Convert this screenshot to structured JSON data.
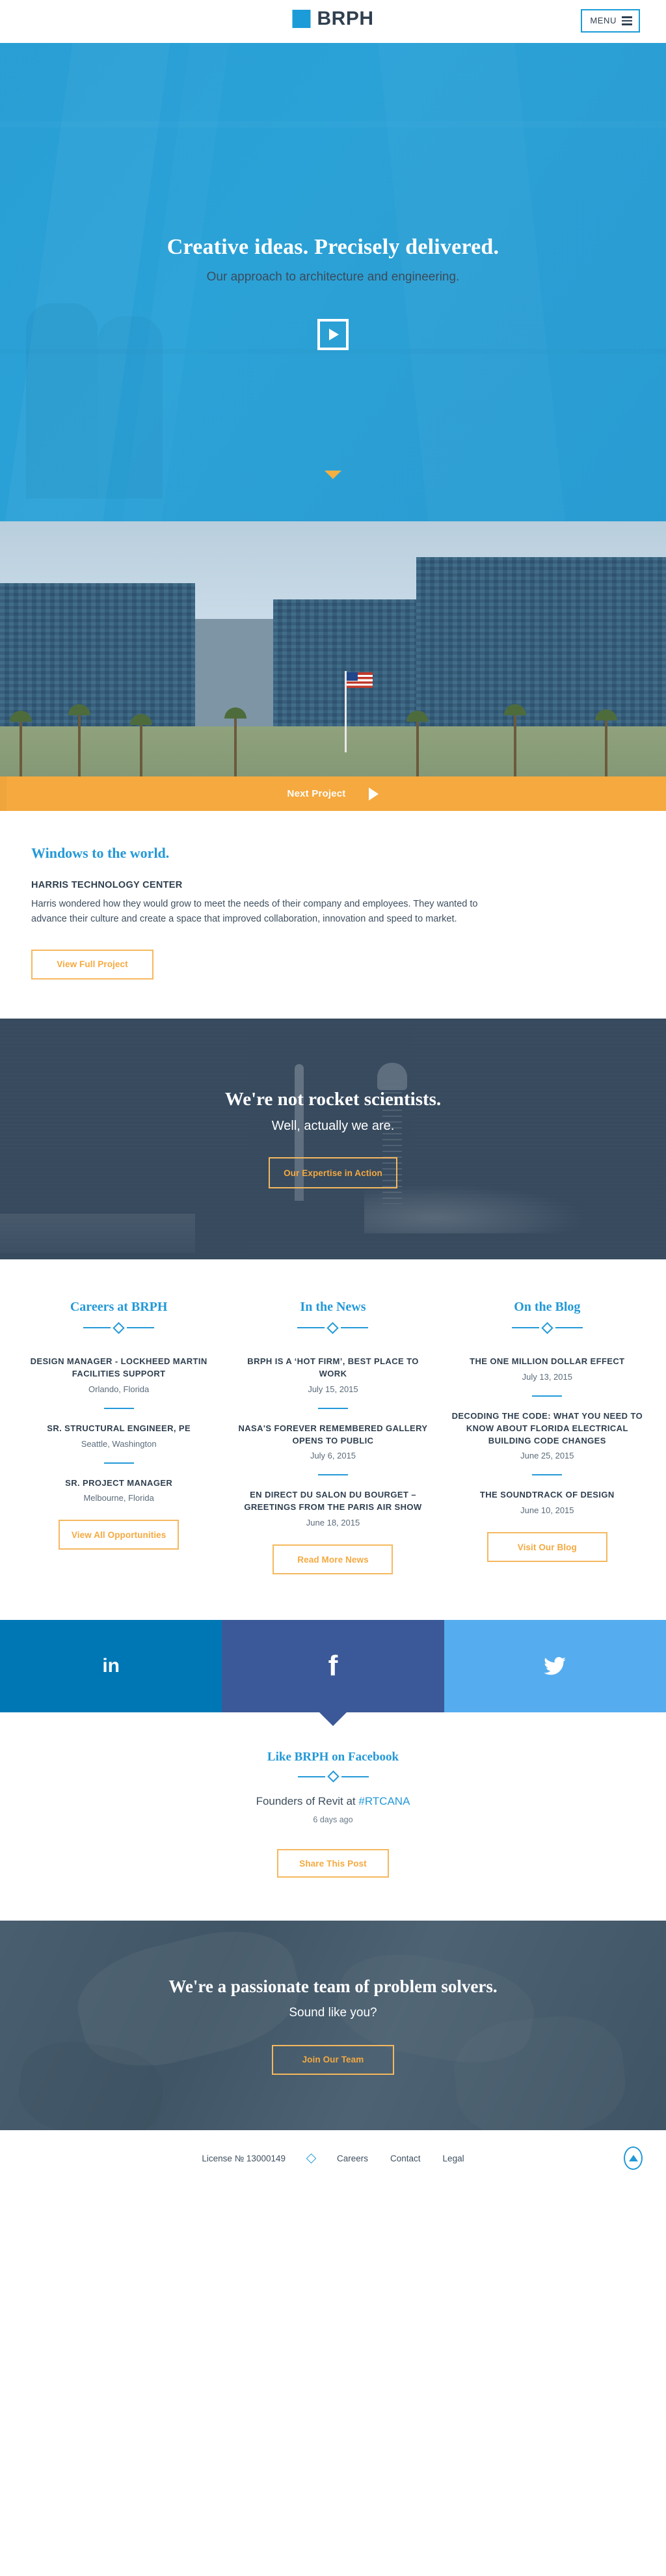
{
  "header": {
    "logo_text": "BRPH",
    "menu_label": "MENU"
  },
  "hero": {
    "title": "Creative ideas. Precisely delivered.",
    "subtitle": "Our approach to architecture and engineering.",
    "play_icon": "play-icon",
    "scroll_icon": "chevron-down-icon"
  },
  "project": {
    "next_project_label": "Next Project",
    "headline": "Windows to the world.",
    "subhead": "HARRIS TECHNOLOGY CENTER",
    "body": "Harris wondered how they would grow to meet the needs of their company and employees. They wanted to advance their culture and create a space that improved collaboration, innovation and speed to market.",
    "button_label": "View Full Project"
  },
  "expertise": {
    "title": "We're not rocket scientists.",
    "subtitle": "Well, actually we are.",
    "button_label": "Our Expertise in Action"
  },
  "columns": [
    {
      "heading": "Careers at BRPH",
      "button_label": "View All Opportunities",
      "items": [
        {
          "title": "DESIGN MANAGER - LOCKHEED MARTIN FACILITIES SUPPORT",
          "meta": "Orlando, Florida"
        },
        {
          "title": "SR. STRUCTURAL ENGINEER, PE",
          "meta": "Seattle, Washington"
        },
        {
          "title": "SR. PROJECT MANAGER",
          "meta": "Melbourne, Florida"
        }
      ]
    },
    {
      "heading": "In the News",
      "button_label": "Read More News",
      "items": [
        {
          "title": "BRPH IS A ‘HOT FIRM’, BEST PLACE TO WORK",
          "meta": "July 15, 2015"
        },
        {
          "title": "NASA'S FOREVER REMEMBERED GALLERY OPENS TO PUBLIC",
          "meta": "July 6, 2015"
        },
        {
          "title": "EN DIRECT DU SALON DU BOURGET – GREETINGS FROM THE PARIS AIR SHOW",
          "meta": "June 18, 2015"
        }
      ]
    },
    {
      "heading": "On the Blog",
      "button_label": "Visit Our Blog",
      "items": [
        {
          "title": "THE ONE MILLION DOLLAR EFFECT",
          "meta": "July 13, 2015"
        },
        {
          "title": "DECODING THE CODE: WHAT YOU NEED TO KNOW ABOUT FLORIDA ELECTRICAL BUILDING CODE CHANGES",
          "meta": "June 25, 2015"
        },
        {
          "title": "THE SOUNDTRACK OF DESIGN",
          "meta": "June 10, 2015"
        }
      ]
    }
  ],
  "social": {
    "linkedin_glyph": "in",
    "facebook_glyph": "f",
    "twitter_glyph": "🐦",
    "linkedin_color": "#0077b5",
    "facebook_color": "#3b5998",
    "twitter_color": "#55acee"
  },
  "facebook_post": {
    "heading": "Like BRPH on Facebook",
    "text_before": "Founders of Revit at ",
    "hashtag": "#RTCANA",
    "timestamp": "6 days ago",
    "button_label": "Share This Post"
  },
  "cta": {
    "title": "We're a passionate team of problem solvers.",
    "subtitle": "Sound like you?",
    "button_label": "Join Our Team"
  },
  "footer": {
    "license": "License № 13000149",
    "links": [
      "Careers",
      "Contact",
      "Legal"
    ],
    "to_top_icon": "arrow-up-icon"
  },
  "colors": {
    "brand_blue": "#2399d8",
    "accent_orange": "#f5a93f",
    "dark_navy": "#374a5e"
  }
}
